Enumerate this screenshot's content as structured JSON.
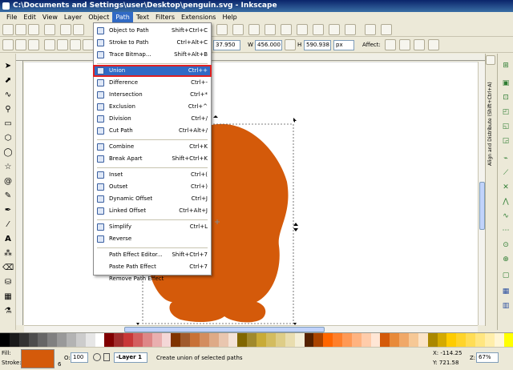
{
  "window": {
    "title": "C:\\Documents and Settings\\user\\Desktop\\penguin.svg - Inkscape"
  },
  "menubar": {
    "items": [
      {
        "label": "File",
        "active": false
      },
      {
        "label": "Edit",
        "active": false
      },
      {
        "label": "View",
        "active": false
      },
      {
        "label": "Layer",
        "active": false
      },
      {
        "label": "Object",
        "active": false
      },
      {
        "label": "Path",
        "active": true
      },
      {
        "label": "Text",
        "active": false
      },
      {
        "label": "Filters",
        "active": false
      },
      {
        "label": "Extensions",
        "active": false
      },
      {
        "label": "Help",
        "active": false
      }
    ]
  },
  "toolbar": {
    "x_value": "37.950",
    "w_label": "W",
    "w_value": "456.000",
    "h_label": "H",
    "h_value": "590.938",
    "unit": "px",
    "affect_label": "Affect:"
  },
  "path_menu": {
    "items": [
      {
        "label": "Object to Path",
        "shortcut": "Shift+Ctrl+C",
        "highlight": false
      },
      {
        "label": "Stroke to Path",
        "shortcut": "Ctrl+Alt+C",
        "highlight": false
      },
      {
        "label": "Trace Bitmap...",
        "shortcut": "Shift+Alt+B",
        "highlight": false
      },
      {
        "label": "Union",
        "shortcut": "Ctrl++",
        "highlight": true
      },
      {
        "label": "Difference",
        "shortcut": "Ctrl+-",
        "highlight": false
      },
      {
        "label": "Intersection",
        "shortcut": "Ctrl+*",
        "highlight": false
      },
      {
        "label": "Exclusion",
        "shortcut": "Ctrl+^",
        "highlight": false
      },
      {
        "label": "Division",
        "shortcut": "Ctrl+/",
        "highlight": false
      },
      {
        "label": "Cut Path",
        "shortcut": "Ctrl+Alt+/",
        "highlight": false
      },
      {
        "label": "Combine",
        "shortcut": "Ctrl+K",
        "highlight": false
      },
      {
        "label": "Break Apart",
        "shortcut": "Shift+Ctrl+K",
        "highlight": false
      },
      {
        "label": "Inset",
        "shortcut": "Ctrl+(",
        "highlight": false
      },
      {
        "label": "Outset",
        "shortcut": "Ctrl+)",
        "highlight": false
      },
      {
        "label": "Dynamic Offset",
        "shortcut": "Ctrl+J",
        "highlight": false
      },
      {
        "label": "Linked Offset",
        "shortcut": "Ctrl+Alt+J",
        "highlight": false
      },
      {
        "label": "Simplify",
        "shortcut": "Ctrl+L",
        "highlight": false
      },
      {
        "label": "Reverse",
        "shortcut": "",
        "highlight": false
      },
      {
        "label": "Path Effect Editor...",
        "shortcut": "Shift+Ctrl+7",
        "highlight": false
      },
      {
        "label": "Paste Path Effect",
        "shortcut": "Ctrl+7",
        "highlight": false
      },
      {
        "label": "Remove Path Effect",
        "shortcut": "",
        "highlight": false
      }
    ]
  },
  "dock": {
    "title": "Align and Distribute (Shift+Ctrl+A)"
  },
  "status": {
    "fill_label": "Fill:",
    "stroke_label": "Stroke:",
    "stroke_value": "6",
    "opacity_label": "O:",
    "opacity_value": "100",
    "layer": "-Layer 1",
    "message": "Create union of selected paths",
    "x_coord": "X: -114.25",
    "y_coord": "Y:  721.58",
    "zoom_label": "Z:",
    "zoom_value": "67%"
  },
  "colors": {
    "shape_fill": "#d45a0a",
    "menu_highlight": "#316ac5",
    "highlight_outline": "#e02020"
  },
  "palette": [
    "#000000",
    "#1a1a1a",
    "#333333",
    "#4d4d4d",
    "#666666",
    "#808080",
    "#999999",
    "#b3b3b3",
    "#cccccc",
    "#e6e6e6",
    "#ffffff",
    "#800000",
    "#a02c2c",
    "#c83737",
    "#d35f5f",
    "#de8787",
    "#e9afaf",
    "#f4d7d7",
    "#803300",
    "#a05a2c",
    "#c87137",
    "#d38d5f",
    "#deaa87",
    "#e9c6af",
    "#f4e3d7",
    "#806600",
    "#a0892c",
    "#c8ab37",
    "#d3bc5f",
    "#decd87",
    "#e9ddaf",
    "#f4eed7",
    "#552200",
    "#aa4400",
    "#ff6600",
    "#ff7f2a",
    "#ff9955",
    "#ffb380",
    "#ffccaa",
    "#ffe6d5",
    "#d45a0a",
    "#e88a3a",
    "#f0a868",
    "#f6c896",
    "#fbe4c8",
    "#aa8800",
    "#d4aa00",
    "#ffcc00",
    "#ffd42a",
    "#ffdd55",
    "#ffe680",
    "#ffeeaa",
    "#fff6d5",
    "#ffff00"
  ]
}
